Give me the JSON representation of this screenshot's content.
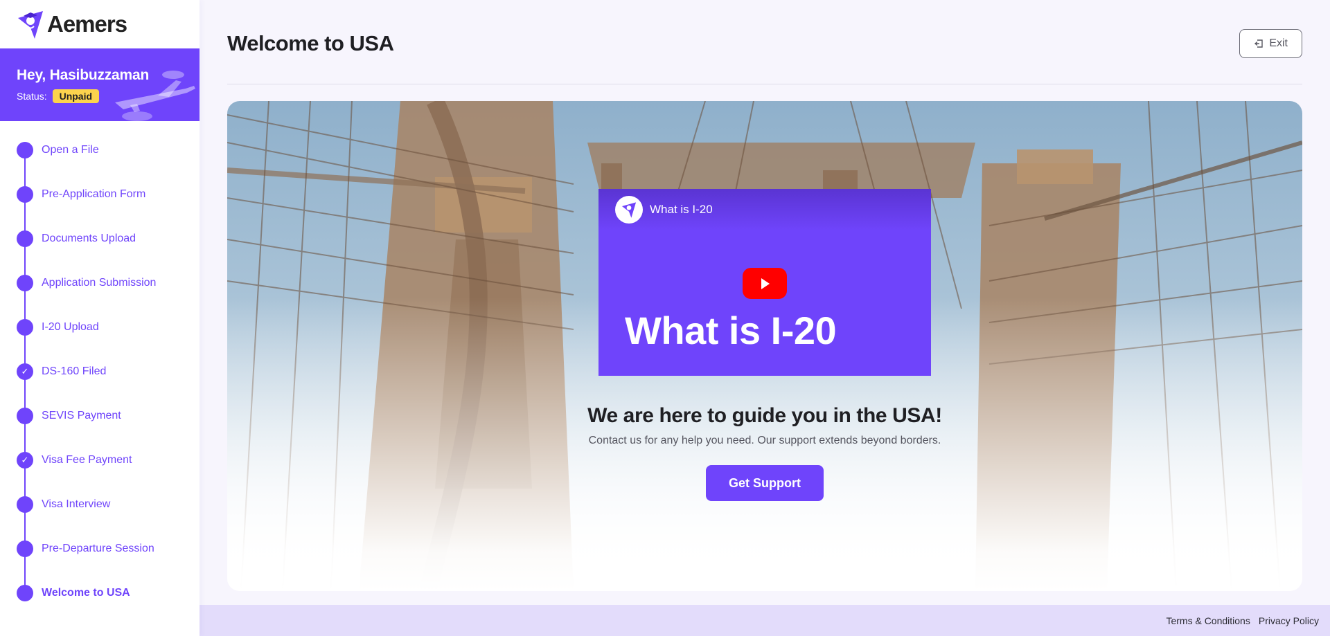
{
  "brand": {
    "name": "Aemers",
    "accent": "#6f44fb"
  },
  "user": {
    "greeting": "Hey, Hasibuzzaman",
    "status_label": "Status:",
    "status_value": "Unpaid"
  },
  "steps": [
    {
      "label": "Open a File",
      "done": false
    },
    {
      "label": "Pre-Application Form",
      "done": false
    },
    {
      "label": "Documents Upload",
      "done": false
    },
    {
      "label": "Application Submission",
      "done": false
    },
    {
      "label": "I-20 Upload",
      "done": false
    },
    {
      "label": "DS-160 Filed",
      "done": true
    },
    {
      "label": "SEVIS Payment",
      "done": false
    },
    {
      "label": "Visa Fee Payment",
      "done": true
    },
    {
      "label": "Visa Interview",
      "done": false
    },
    {
      "label": "Pre-Departure Session",
      "done": false
    },
    {
      "label": "Welcome to USA",
      "done": false,
      "active": true
    }
  ],
  "header": {
    "title": "Welcome to USA",
    "exit_label": "Exit"
  },
  "video": {
    "channel_title": "What is I-20",
    "thumbnail_title": "What is I-20"
  },
  "hero": {
    "heading": "We are here to guide you in the USA!",
    "subtext": "Contact us for any help you need. Our support extends beyond borders.",
    "button_label": "Get Support"
  },
  "footer": {
    "terms": "Terms & Conditions",
    "privacy": "Privacy Policy"
  }
}
